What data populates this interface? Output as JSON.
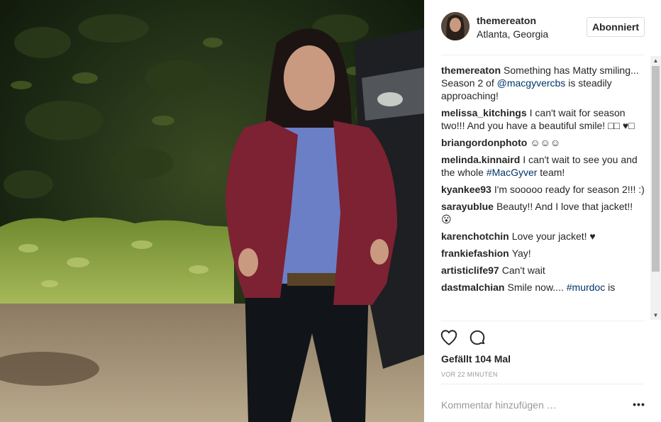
{
  "post": {
    "username": "themereaton",
    "location": "Atlanta, Georgia",
    "follow_label": "Abonniert",
    "photo_icon": "person-photo",
    "caption": {
      "user": "themereaton",
      "text_before": "Something has Matty smiling... Season 2 of ",
      "mention": "@macgyvercbs",
      "text_after": " is steadily approaching!"
    },
    "comments": [
      {
        "user": "melissa_kitchings",
        "pre": "I can't wait for season two!!! And you have a beautiful smile! □□ ♥□",
        "mention": "",
        "post": ""
      },
      {
        "user": "briangordonphoto",
        "pre": "☺☺☺",
        "mention": "",
        "post": ""
      },
      {
        "user": "melinda.kinnaird",
        "pre": "I can't wait to see you and the whole ",
        "mention": "#MacGyver",
        "post": " team!"
      },
      {
        "user": "kyankee93",
        "pre": "I'm sooooo ready for season 2!!! :)",
        "mention": "",
        "post": ""
      },
      {
        "user": "sarayublue",
        "pre": "Beauty!! And I love that jacket!! 😮",
        "mention": "",
        "post": ""
      },
      {
        "user": "karenchotchin",
        "pre": "Love your jacket! ♥",
        "mention": "",
        "post": ""
      },
      {
        "user": "frankiefashion",
        "pre": "Yay!",
        "mention": "",
        "post": ""
      },
      {
        "user": "artisticlife97",
        "pre": "Can't wait",
        "mention": "",
        "post": ""
      },
      {
        "user": "dastmalchian",
        "pre": "Smile now.... ",
        "mention": "#murdoc",
        "post": " is"
      }
    ],
    "likes": "Gefällt 104 Mal",
    "timestamp": "VOR 22 MINUTEN",
    "comment_placeholder": "Kommentar hinzufügen …",
    "more_label": "•••",
    "icons": {
      "like": "heart-outline-icon",
      "comment": "comment-bubble-icon",
      "more": "more-options-icon"
    },
    "colors": {
      "mention": "#003569",
      "text": "#262626",
      "muted": "#999999",
      "border": "#dbdbdb"
    }
  }
}
